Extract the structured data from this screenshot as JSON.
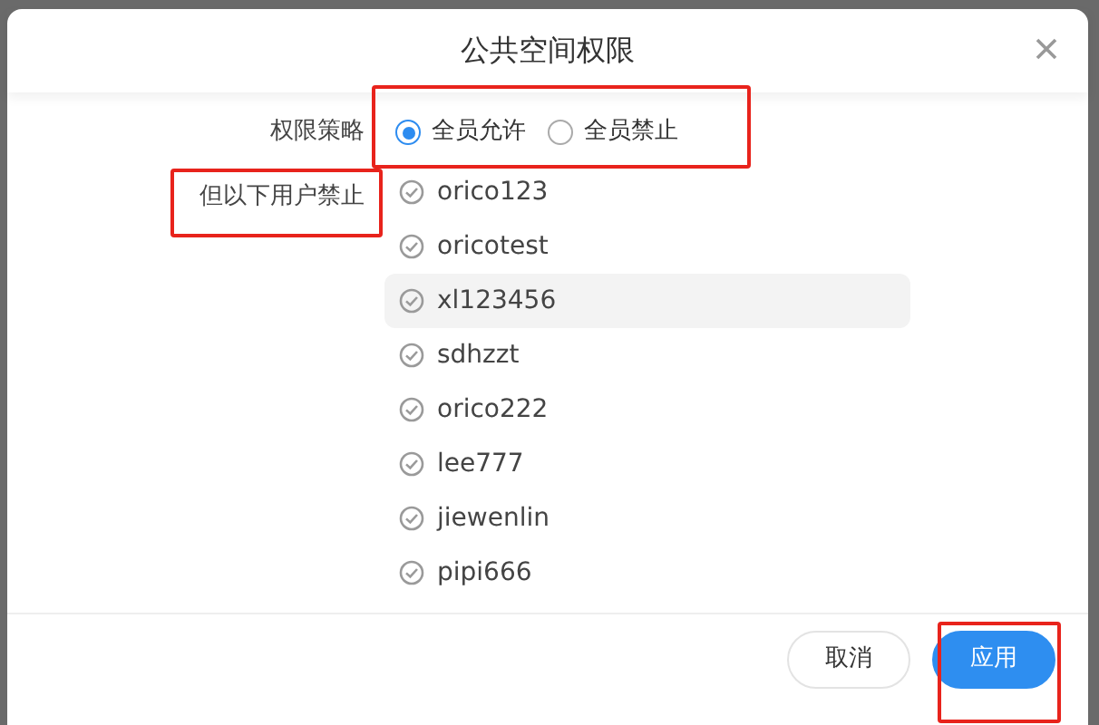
{
  "dialog": {
    "title": "公共空间权限",
    "policy": {
      "label": "权限策略",
      "options": [
        {
          "label": "全员允许",
          "selected": true
        },
        {
          "label": "全员禁止",
          "selected": false
        }
      ]
    },
    "exceptions": {
      "label": "但以下用户禁止",
      "users": [
        {
          "name": "orico123",
          "highlighted": false
        },
        {
          "name": "oricotest",
          "highlighted": false
        },
        {
          "name": "xl123456",
          "highlighted": true
        },
        {
          "name": "sdhzzt",
          "highlighted": false
        },
        {
          "name": "orico222",
          "highlighted": false
        },
        {
          "name": "lee777",
          "highlighted": false
        },
        {
          "name": "jiewenlin",
          "highlighted": false
        },
        {
          "name": "pipi666",
          "highlighted": false
        }
      ]
    },
    "buttons": [
      {
        "label": "取消",
        "kind": "secondary"
      },
      {
        "label": "应用",
        "kind": "primary"
      }
    ]
  }
}
